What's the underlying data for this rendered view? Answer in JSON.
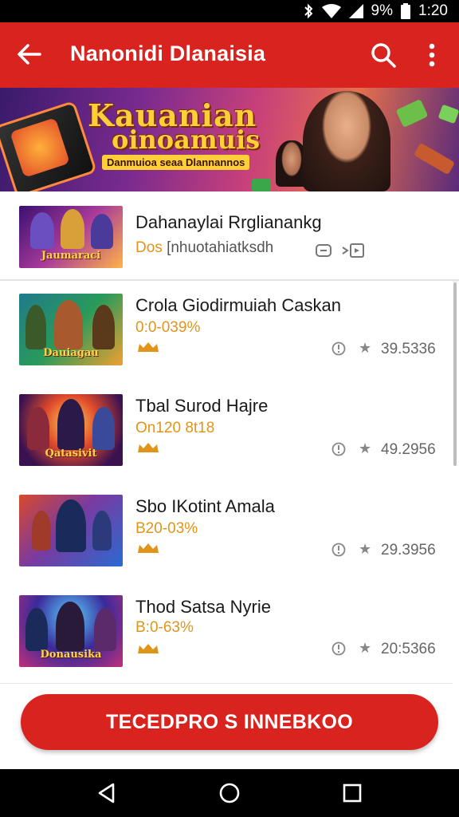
{
  "status": {
    "time": "1:20",
    "battery": "9%"
  },
  "appbar": {
    "title": "Nanonidi Dlanaisia"
  },
  "banner": {
    "line1": "Kauanian",
    "line2": "oinoamuis",
    "line3": "Danmuioa seaa Dlannannos"
  },
  "featured": {
    "title": "Dahanaylai Rrglianankg",
    "sub_prefix": "Dos",
    "sub_rest": "[nhuotahiatksdh",
    "thumb_caption": "Jaumaraci"
  },
  "games": [
    {
      "title": "Crola Giodirmuiah Caskan",
      "sub": "0:0-039%",
      "count": "39.5336",
      "thumb_caption": "Dauiagau"
    },
    {
      "title": "Tbal Surod Hajre",
      "sub": "On120 8t18",
      "count": "49.2956",
      "thumb_caption": "Qatasivit"
    },
    {
      "title": "Sbo IKotint Amala",
      "sub": "B20-03%",
      "count": "29.3956",
      "thumb_caption": ""
    },
    {
      "title": "Thod Satsa Nyrie",
      "sub": "B:0-63%",
      "count": "20:5366",
      "thumb_caption": "Donausika"
    }
  ],
  "cta": {
    "label": "TECEDPRO S INNEBKOO"
  },
  "icons": {
    "bluetooth": "bluetooth-icon",
    "wifi": "wifi-icon",
    "signal": "signal-icon",
    "battery": "battery-icon",
    "back": "arrow-left-icon",
    "search": "search-icon",
    "more": "more-vert-icon",
    "info": "info-icon",
    "star": "star-icon",
    "badge": "crown-badge-icon",
    "nav_back": "triangle-back-icon",
    "nav_home": "circle-home-icon",
    "nav_recents": "square-recents-icon"
  },
  "colors": {
    "brand": "#d9231f",
    "accent": "#e0951a"
  }
}
